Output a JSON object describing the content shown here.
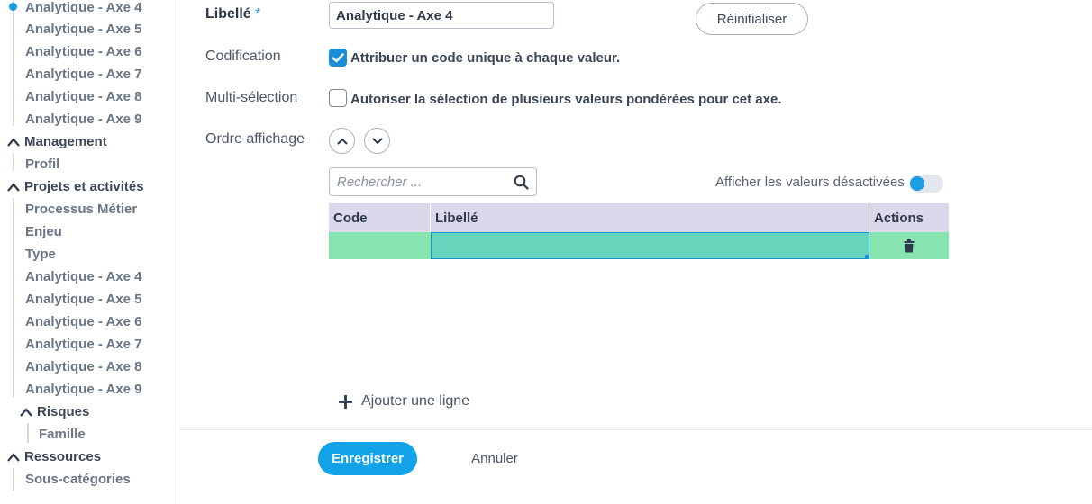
{
  "sidebar": {
    "group1_items": [
      "Analytique - Axe 4",
      "Analytique - Axe 5",
      "Analytique - Axe 6",
      "Analytique - Axe 7",
      "Analytique - Axe 8",
      "Analytique - Axe 9"
    ],
    "management": {
      "label": "Management",
      "items": [
        "Profil"
      ]
    },
    "projets": {
      "label": "Projets et activités",
      "items": [
        "Processus Métier",
        "Enjeu",
        "Type",
        "Analytique - Axe 4",
        "Analytique - Axe 5",
        "Analytique - Axe 6",
        "Analytique - Axe 7",
        "Analytique - Axe 8",
        "Analytique - Axe 9"
      ],
      "risques": {
        "label": "Risques",
        "items": [
          "Famille"
        ]
      }
    },
    "ressources": {
      "label": "Ressources",
      "items": [
        "Sous-catégories"
      ]
    }
  },
  "form": {
    "libelle_label": "Libellé",
    "required_mark": "*",
    "libelle_value": "Analytique - Axe 4",
    "reset_label": "Réinitialiser",
    "codification_label": "Codification",
    "codification_checked": true,
    "codification_text": "Attribuer un code unique à chaque valeur.",
    "multiselect_label": "Multi-sélection",
    "multiselect_checked": false,
    "multiselect_text": "Autoriser la sélection de plusieurs valeurs pondérées pour cet axe.",
    "order_label": "Ordre affichage"
  },
  "values_table": {
    "search_placeholder": "Rechercher ...",
    "show_disabled_label": "Afficher les valeurs désactivées",
    "show_disabled_on": false,
    "columns": [
      "Code",
      "Libellé",
      "Actions"
    ],
    "rows": [
      {
        "code": "",
        "libelle": ""
      }
    ],
    "add_line_label": "Ajouter une ligne"
  },
  "footer": {
    "save_label": "Enregistrer",
    "cancel_label": "Annuler"
  },
  "colors": {
    "accent": "#1a9ee4",
    "row_highlight": "#87e4b1",
    "cell_selected": "#67d5bc",
    "header_bg": "#dcd8eb"
  }
}
